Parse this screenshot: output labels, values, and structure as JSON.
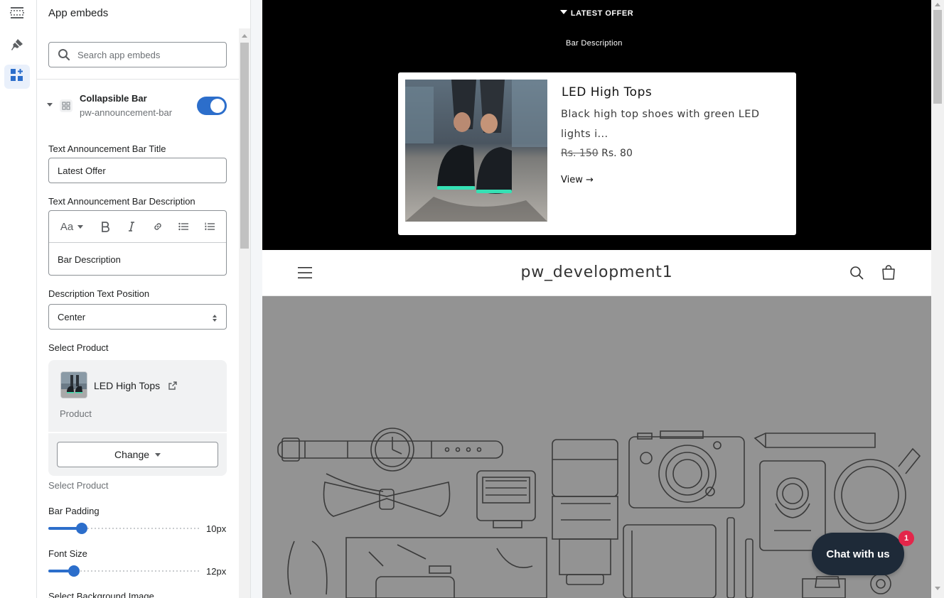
{
  "colors": {
    "accent": "#2c6ecb",
    "announcement_bg": "#000000",
    "hero_bg": "#939393",
    "chat_bg": "#1e2a38",
    "badge": "#e3264a"
  },
  "rail": {
    "icons": [
      "sections-icon",
      "theme-styles-icon",
      "app-embeds-icon"
    ],
    "active": "app-embeds-icon"
  },
  "panel": {
    "title": "App embeds",
    "search_placeholder": "Search app embeds",
    "embed": {
      "name": "Collapsible Bar",
      "handle": "pw-announcement-bar",
      "enabled": true
    },
    "title_field": {
      "label": "Text Announcement Bar Title",
      "value": "Latest Offer"
    },
    "desc_field": {
      "label": "Text Announcement Bar Description",
      "font_btn": "Aa",
      "value": "Bar Description"
    },
    "position_field": {
      "label": "Description Text Position",
      "value": "Center"
    },
    "product": {
      "label": "Select Product",
      "name": "LED High Tops",
      "type": "Product",
      "change_label": "Change",
      "helper": "Select Product"
    },
    "bar_padding": {
      "label": "Bar Padding",
      "value": "10px",
      "fraction": 0.22
    },
    "font_size": {
      "label": "Font Size",
      "value": "12px",
      "fraction": 0.17
    },
    "bg_image_label": "Select Background Image"
  },
  "preview": {
    "announcement": {
      "title": "LATEST OFFER",
      "description": "Bar Description",
      "product_name": "LED High Tops",
      "product_desc": "Black high top shoes with green LED lights i...",
      "old_price": "Rs. 150",
      "new_price": "Rs. 80",
      "link": "View →"
    },
    "store_name": "pw_development1",
    "chat": {
      "label": "Chat with us",
      "badge": "1"
    }
  }
}
